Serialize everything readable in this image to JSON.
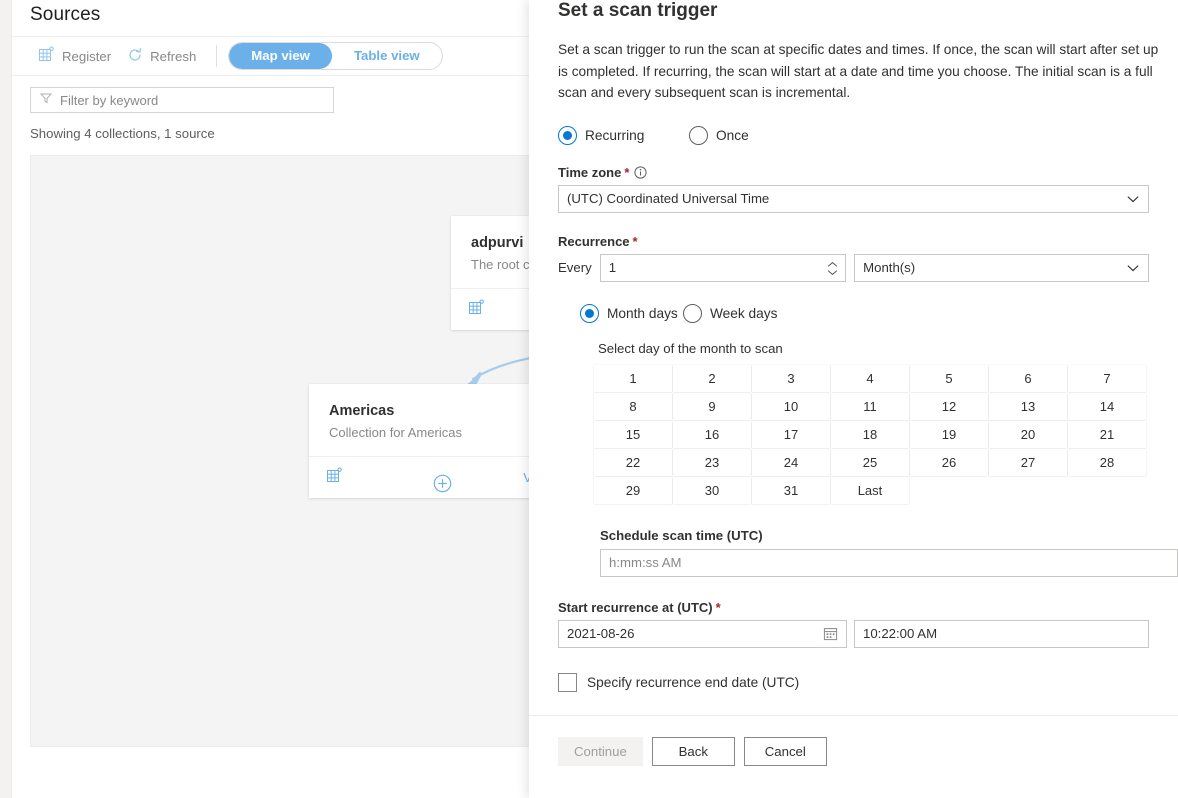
{
  "colors": {
    "accent_blue": "#0078d4",
    "pivot_blue": "#6bb0e8",
    "required_red": "#a4262c",
    "canvas_gray": "#f4f4f4"
  },
  "sources_page": {
    "title": "Sources",
    "commands": [
      {
        "label": "Register",
        "icon": "register-grid-icon"
      },
      {
        "label": "Refresh",
        "icon": "refresh-icon"
      }
    ],
    "pivot": {
      "selected": "Map view",
      "items": [
        "Map view",
        "Table view"
      ]
    },
    "filter": {
      "placeholder": "Filter by keyword",
      "icon": "filter-icon",
      "value": ""
    },
    "status": "Showing 4 collections, 1 source",
    "map": {
      "cards": [
        {
          "name": "adpurvi",
          "description": "The root c",
          "icon": "collection-grid-icon",
          "link": ""
        },
        {
          "name": "Americas",
          "description": "Collection for Americas",
          "icon": "collection-grid-icon",
          "link": "View d"
        }
      ],
      "add_button": "add-collection-icon"
    }
  },
  "panel": {
    "title": "Set a scan trigger",
    "description": "Set a scan trigger to run the scan at specific dates and times. If once, the scan will start after set up is completed. If recurring, the scan will start at a date and time you choose. The initial scan is a full scan and every subsequent scan is incremental.",
    "trigger_type": {
      "selected": "Recurring",
      "options": [
        "Recurring",
        "Once"
      ]
    },
    "time_zone": {
      "label": "Time zone",
      "required": "*",
      "info_icon": "info-icon",
      "value": "(UTC) Coordinated Universal Time"
    },
    "recurrence": {
      "label": "Recurrence",
      "required": "*",
      "every_label": "Every",
      "every_value": "1",
      "unit_value": "Month(s)",
      "mode": {
        "selected": "Month days",
        "options": [
          "Month days",
          "Week days"
        ]
      },
      "day_picker_label": "Select day of the month to scan",
      "days": [
        "1",
        "2",
        "3",
        "4",
        "5",
        "6",
        "7",
        "8",
        "9",
        "10",
        "11",
        "12",
        "13",
        "14",
        "15",
        "16",
        "17",
        "18",
        "19",
        "20",
        "21",
        "22",
        "23",
        "24",
        "25",
        "26",
        "27",
        "28",
        "29",
        "30",
        "31",
        "Last"
      ],
      "scan_time_label": "Schedule scan time (UTC)",
      "scan_time_placeholder": "h:mm:ss AM",
      "scan_time_value": ""
    },
    "start_recurrence": {
      "label": "Start recurrence at (UTC)",
      "required": "*",
      "date_value": "2021-08-26",
      "date_icon": "calendar-icon",
      "time_value": "10:22:00 AM"
    },
    "end_date_checkbox": {
      "label": "Specify recurrence end date (UTC)",
      "checked": false
    },
    "footer": {
      "continue_label": "Continue",
      "continue_disabled": true,
      "back_label": "Back",
      "cancel_label": "Cancel"
    }
  }
}
